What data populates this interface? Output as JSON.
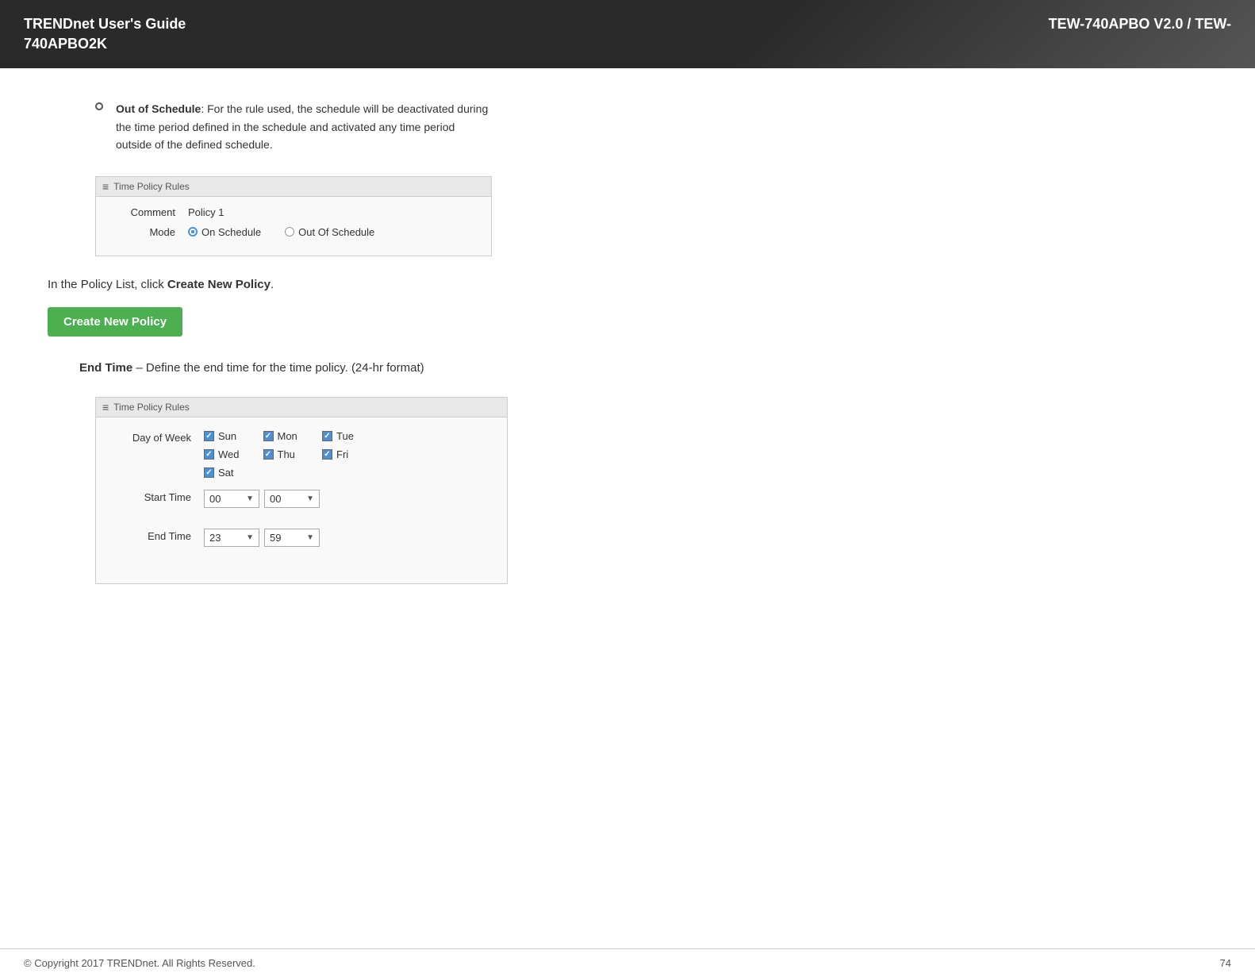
{
  "header": {
    "left_line1": "TRENDnet User's Guide",
    "left_line2": "740APBO2K",
    "right": "TEW-740APBO V2.0 / TEW-"
  },
  "bullet": {
    "term": "Out of Schedule",
    "colon": ":",
    "description": " For the rule used, the schedule will be deactivated during the time period defined in the schedule and activated any time period outside of the defined schedule."
  },
  "first_screenshot": {
    "title": "Time Policy Rules",
    "comment_label": "Comment",
    "comment_value": "Policy 1",
    "mode_label": "Mode",
    "on_schedule_label": "On Schedule",
    "out_schedule_label": "Out Of Schedule"
  },
  "instruction": {
    "text_before": "In the Policy List, click ",
    "link_text": "Create New Policy",
    "text_after": "."
  },
  "create_button": {
    "label": "Create New Policy"
  },
  "end_time": {
    "term": "End Time",
    "description": " – Define the end time for the time policy. (24-hr format)"
  },
  "second_screenshot": {
    "title": "Time Policy Rules",
    "day_of_week_label": "Day of Week",
    "days": [
      {
        "id": "sun",
        "label": "Sun",
        "checked": true
      },
      {
        "id": "mon",
        "label": "Mon",
        "checked": true
      },
      {
        "id": "tue",
        "label": "Tue",
        "checked": true
      },
      {
        "id": "wed",
        "label": "Wed",
        "checked": true
      },
      {
        "id": "thu",
        "label": "Thu",
        "checked": true
      },
      {
        "id": "fri",
        "label": "Fri",
        "checked": true
      },
      {
        "id": "sat",
        "label": "Sat",
        "checked": true
      }
    ],
    "start_time_label": "Start Time",
    "start_hour": "00",
    "start_min": "00",
    "end_time_label": "End Time",
    "end_hour": "23",
    "end_min": "59"
  },
  "footer": {
    "copyright": "© Copyright 2017 TRENDnet. All Rights Reserved.",
    "page_number": "74"
  }
}
